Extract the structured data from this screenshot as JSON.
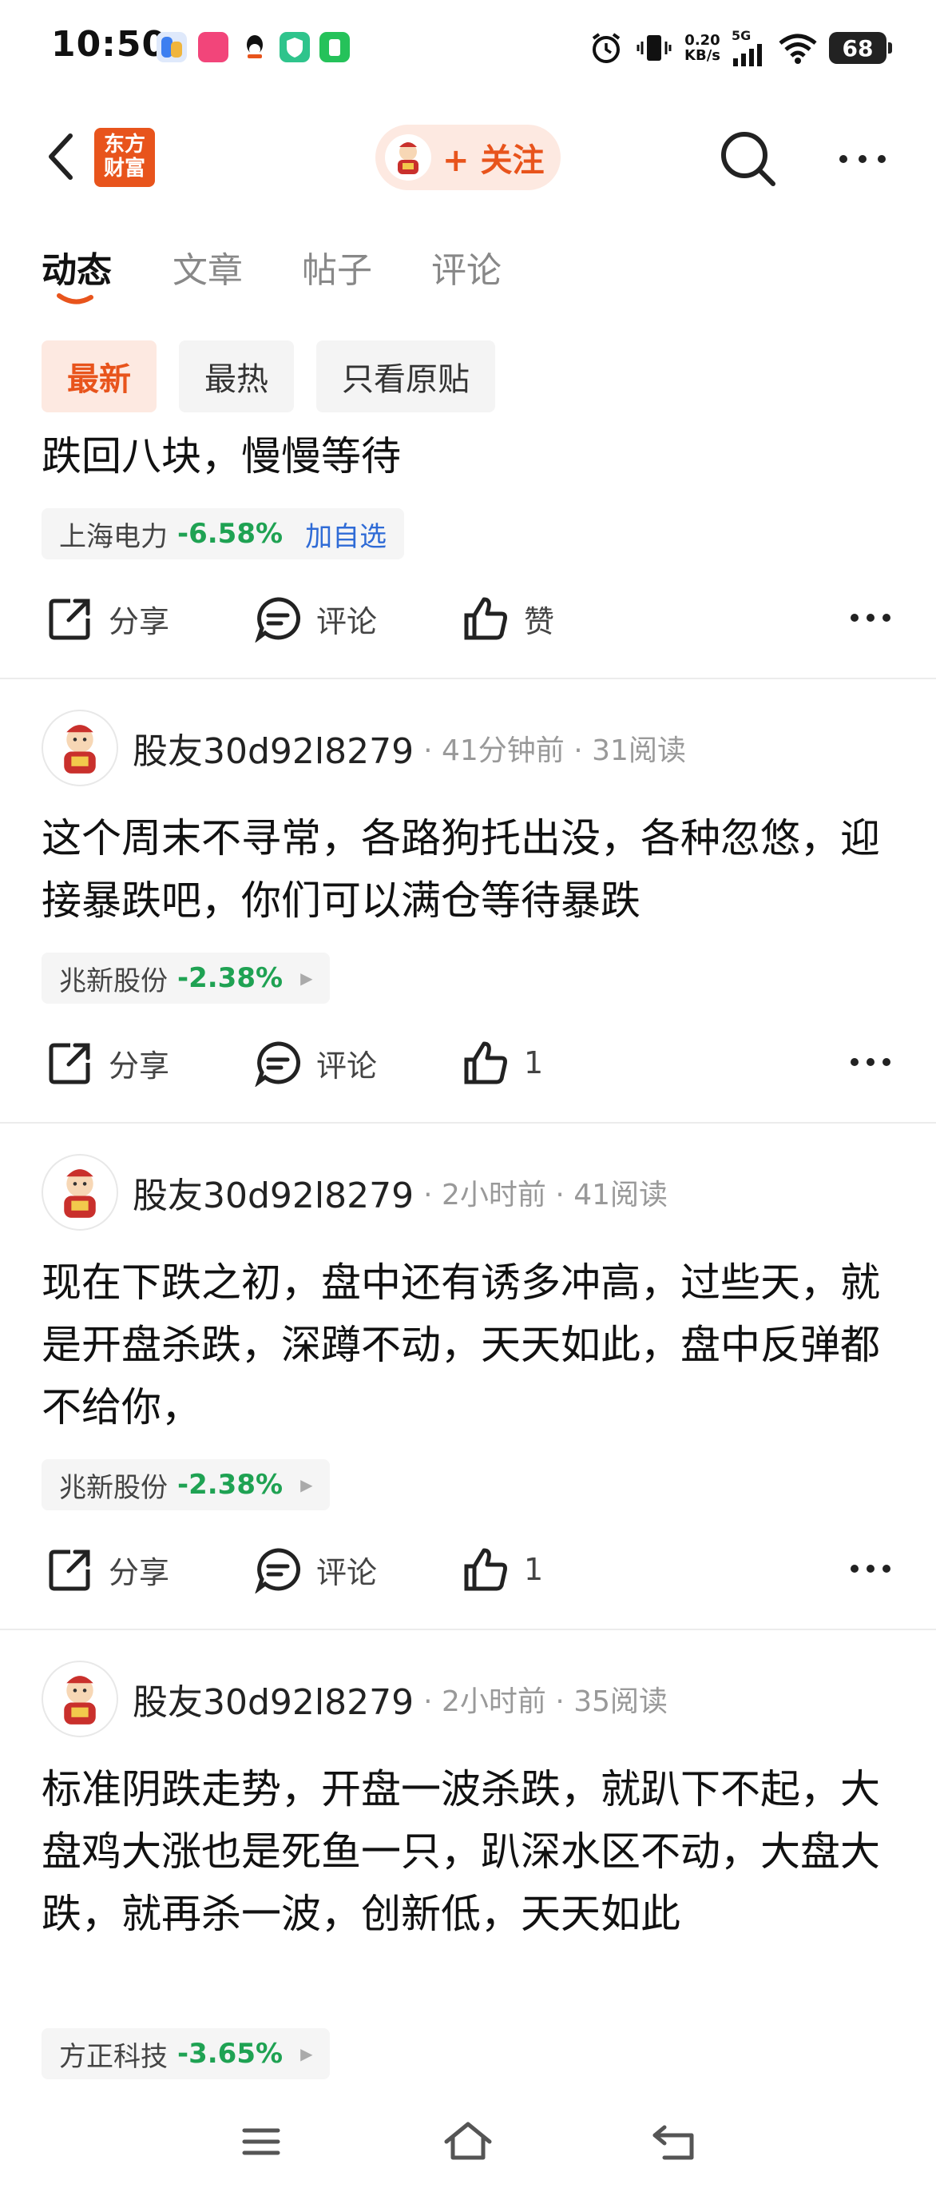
{
  "status_bar": {
    "time": "10:50",
    "net_speed_value": "0.20",
    "net_speed_unit": "KB/s",
    "network": "5G",
    "battery": "68"
  },
  "header": {
    "logo_text_line1": "东方",
    "logo_text_line2": "财富",
    "follow_label": "+ 关注",
    "accent_color": "#e8541c"
  },
  "tabs": [
    {
      "label": "动态",
      "active": true
    },
    {
      "label": "文章",
      "active": false
    },
    {
      "label": "帖子",
      "active": false
    },
    {
      "label": "评论",
      "active": false
    }
  ],
  "filters": [
    {
      "label": "最新",
      "active": true
    },
    {
      "label": "最热",
      "active": false
    },
    {
      "label": "只看原贴",
      "active": false
    }
  ],
  "posts": [
    {
      "body": "跌回八块，慢慢等待",
      "stock": {
        "name": "上海电力",
        "change": "-6.58%",
        "action": "加自选"
      },
      "actions": {
        "share": "分享",
        "comment": "评论",
        "like": "赞"
      }
    },
    {
      "author": "股友30d92l8279",
      "time": "· 41分钟前 · 31阅读",
      "body": "这个周末不寻常，各路狗托出没，各种忽悠，迎接暴跌吧，你们可以满仓等待暴跌",
      "stock": {
        "name": "兆新股份",
        "change": "-2.38%"
      },
      "actions": {
        "share": "分享",
        "comment": "评论",
        "like": "1"
      }
    },
    {
      "author": "股友30d92l8279",
      "time": "· 2小时前 · 41阅读",
      "body": "现在下跌之初，盘中还有诱多冲高，过些天，就是开盘杀跌，深蹲不动，天天如此，盘中反弹都不给你，",
      "stock": {
        "name": "兆新股份",
        "change": "-2.38%"
      },
      "actions": {
        "share": "分享",
        "comment": "评论",
        "like": "1"
      }
    },
    {
      "author": "股友30d92l8279",
      "time": "· 2小时前 · 35阅读",
      "body": "标准阴跌走势，开盘一波杀跌，就趴下不起，大盘鸡大涨也是死鱼一只，趴深水区不动，大盘大跌，就再杀一波，创新低，天天如此",
      "stock": {
        "name": "方正科技",
        "change": "-3.65%"
      }
    }
  ],
  "colors": {
    "down": "#1fa253",
    "link": "#2f6bd6"
  },
  "icons": [
    "back-icon",
    "search-icon",
    "more-icon",
    "share-icon",
    "comment-icon",
    "like-icon",
    "menu-icon",
    "home-icon",
    "back-nav-icon"
  ]
}
